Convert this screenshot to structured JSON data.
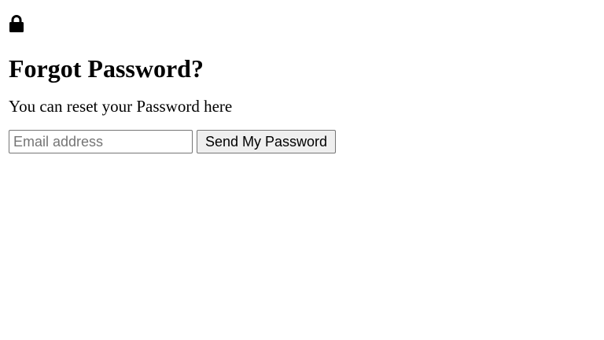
{
  "header": {
    "icon": "lock-icon",
    "title": "Forgot Password?",
    "subtitle": "You can reset your Password here"
  },
  "form": {
    "email": {
      "value": "",
      "placeholder": "Email address"
    },
    "submit_label": "Send My Password"
  }
}
